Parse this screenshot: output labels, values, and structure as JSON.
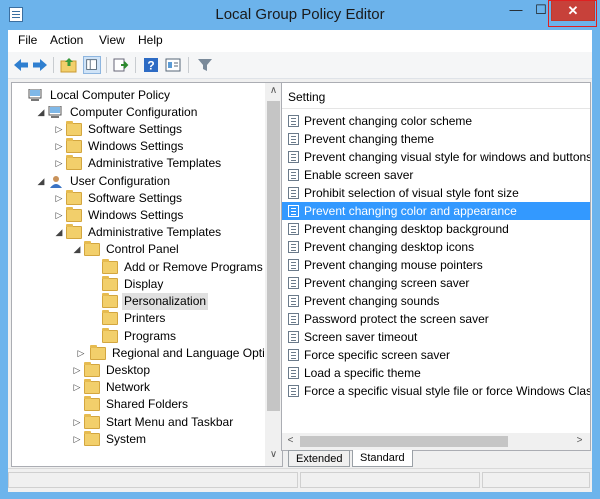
{
  "window": {
    "title": "Local Group Policy Editor",
    "close_glyph": "✕",
    "minimize_glyph": "—",
    "maximize_glyph": "☐"
  },
  "menu": {
    "items": [
      "File",
      "Action",
      "View",
      "Help"
    ]
  },
  "toolbar": {
    "icons": [
      "back-arrow-icon",
      "forward-arrow-icon",
      "up-folder-icon",
      "show-hide-tree-icon",
      "export-list-icon",
      "help-icon",
      "properties-icon",
      "filter-icon"
    ]
  },
  "tree": {
    "items": [
      {
        "label": "Local Computer Policy",
        "level": 0,
        "toggle": "",
        "icon": "computer"
      },
      {
        "label": "Computer Configuration",
        "level": 1,
        "toggle": "◢",
        "icon": "computer"
      },
      {
        "label": "Software Settings",
        "level": 2,
        "toggle": "▷",
        "icon": "folder"
      },
      {
        "label": "Windows Settings",
        "level": 2,
        "toggle": "▷",
        "icon": "folder"
      },
      {
        "label": "Administrative Templates",
        "level": 2,
        "toggle": "▷",
        "icon": "folder"
      },
      {
        "label": "User Configuration",
        "level": 1,
        "toggle": "◢",
        "icon": "user"
      },
      {
        "label": "Software Settings",
        "level": 2,
        "toggle": "▷",
        "icon": "folder"
      },
      {
        "label": "Windows Settings",
        "level": 2,
        "toggle": "▷",
        "icon": "folder"
      },
      {
        "label": "Administrative Templates",
        "level": 2,
        "toggle": "◢",
        "icon": "folder"
      },
      {
        "label": "Control Panel",
        "level": 3,
        "toggle": "◢",
        "icon": "folder"
      },
      {
        "label": "Add or Remove Programs",
        "level": 4,
        "toggle": "",
        "icon": "folder"
      },
      {
        "label": "Display",
        "level": 4,
        "toggle": "",
        "icon": "folder"
      },
      {
        "label": "Personalization",
        "level": 4,
        "toggle": "",
        "icon": "folder",
        "selected": true
      },
      {
        "label": "Printers",
        "level": 4,
        "toggle": "",
        "icon": "folder"
      },
      {
        "label": "Programs",
        "level": 4,
        "toggle": "",
        "icon": "folder"
      },
      {
        "label": "Regional and Language Optio",
        "level": 4,
        "toggle": "▷",
        "icon": "folder"
      },
      {
        "label": "Desktop",
        "level": 3,
        "toggle": "▷",
        "icon": "folder"
      },
      {
        "label": "Network",
        "level": 3,
        "toggle": "▷",
        "icon": "folder"
      },
      {
        "label": "Shared Folders",
        "level": 3,
        "toggle": "",
        "icon": "folder"
      },
      {
        "label": "Start Menu and Taskbar",
        "level": 3,
        "toggle": "▷",
        "icon": "folder"
      },
      {
        "label": "System",
        "level": 3,
        "toggle": "▷",
        "icon": "folder"
      }
    ]
  },
  "settings": {
    "header": "Setting",
    "rows": [
      "Prevent changing color scheme",
      "Prevent changing theme",
      "Prevent changing visual style for windows and buttons",
      "Enable screen saver",
      "Prohibit selection of visual style font size",
      "Prevent changing color and appearance",
      "Prevent changing desktop background",
      "Prevent changing desktop icons",
      "Prevent changing mouse pointers",
      "Prevent changing screen saver",
      "Prevent changing sounds",
      "Password protect the screen saver",
      "Screen saver timeout",
      "Force specific screen saver",
      "Load a specific theme",
      "Force a specific visual style file or force Windows Classic"
    ],
    "selected_row": "Prevent changing color and appearance"
  },
  "tabs": {
    "extended": "Extended",
    "standard": "Standard",
    "active": "Standard"
  },
  "scroll": {
    "up": "∧",
    "down": "∨",
    "left": "<",
    "right": ">"
  },
  "colors": {
    "titlebar": "#6cb3eb",
    "selection": "#3399ff",
    "close": "#c7413a"
  }
}
